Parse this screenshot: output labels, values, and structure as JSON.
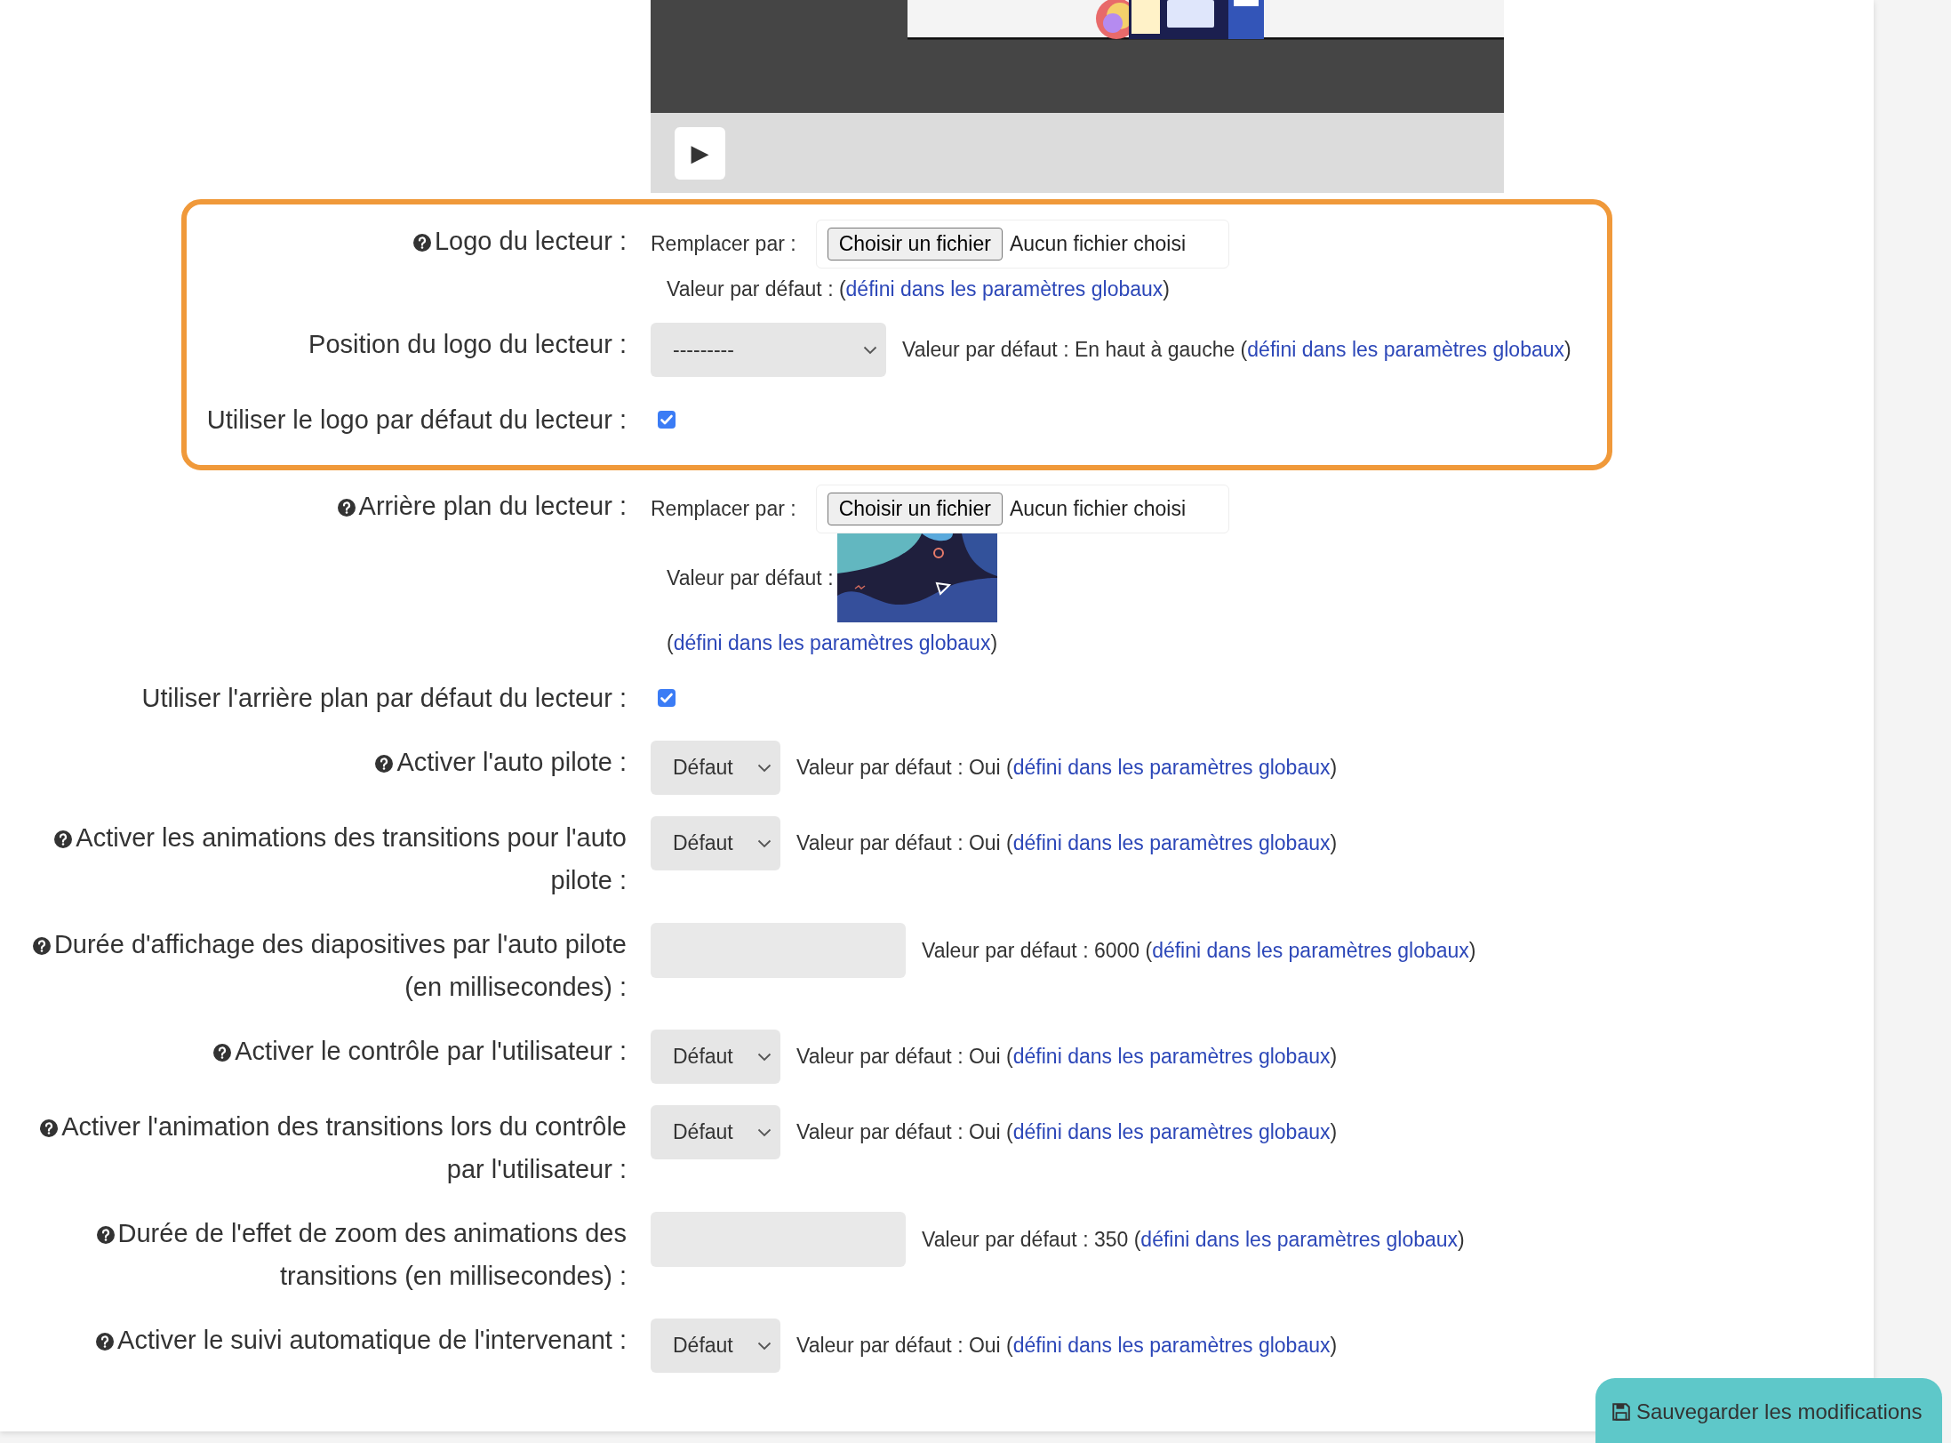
{
  "video_preview": {
    "kind": "picture",
    "play_button": {
      "label": "▶"
    }
  },
  "sections": [
    {
      "highlighted": true,
      "fields": [
        {
          "kind": "file",
          "help": true,
          "label": "Logo du lecteur :",
          "replace_label": "Remplacer par :",
          "button": "Choisir un fichier",
          "file_status": "Aucun fichier choisi",
          "default_prefix": "Valeur par défaut : (",
          "link": "défini dans les paramètres globaux",
          "default_suffix": ")"
        },
        {
          "kind": "select",
          "help": false,
          "label": "Position du logo du lecteur :",
          "value": "---------",
          "default_prefix": "Valeur par défaut : En haut à gauche (",
          "link": "défini dans les paramètres globaux",
          "default_suffix": ")"
        },
        {
          "kind": "checkbox",
          "help": false,
          "label": "Utiliser le logo par défaut du lecteur :",
          "checked": true
        }
      ]
    },
    {
      "highlighted": false,
      "fields": [
        {
          "kind": "file",
          "help": true,
          "label": "Arrière plan du lecteur :",
          "replace_label": "Remplacer par :",
          "button": "Choisir un fichier",
          "file_status": "Aucun fichier choisi",
          "default_prefix": "Valeur par défaut :",
          "default_link_prefix": "(",
          "link": "défini dans les paramètres globaux",
          "default_suffix": ")"
        },
        {
          "kind": "checkbox",
          "help": false,
          "label": "Utiliser l'arrière plan par défaut du lecteur :",
          "checked": true
        },
        {
          "kind": "select",
          "help": true,
          "label": "Activer l'auto pilote :",
          "value": "Défaut",
          "default_prefix": "Valeur par défaut : Oui (",
          "link": "défini dans les paramètres globaux",
          "default_suffix": ")"
        },
        {
          "kind": "select",
          "help": true,
          "label": "Activer les animations des transitions pour l'auto pilote :",
          "value": "Défaut",
          "default_prefix": "Valeur par défaut : Oui (",
          "link": "défini dans les paramètres globaux",
          "default_suffix": ")"
        },
        {
          "kind": "input",
          "help": true,
          "label": "Durée d'affichage des diapositives par l'auto pilote (en millisecondes) :",
          "default_prefix": "Valeur par défaut : 6000 (",
          "link": "défini dans les paramètres globaux",
          "default_suffix": ")"
        },
        {
          "kind": "select",
          "help": true,
          "label": "Activer le contrôle par l'utilisateur :",
          "value": "Défaut",
          "default_prefix": "Valeur par défaut : Oui (",
          "link": "défini dans les paramètres globaux",
          "default_suffix": ")"
        },
        {
          "kind": "select",
          "help": true,
          "label": "Activer l'animation des transitions lors du contrôle par l'utilisateur :",
          "value": "Défaut",
          "default_prefix": "Valeur par défaut : Oui (",
          "link": "défini dans les paramètres globaux",
          "default_suffix": ")"
        },
        {
          "kind": "input",
          "help": true,
          "label": "Durée de l'effet de zoom des animations des transitions (en millisecondes) :",
          "default_prefix": "Valeur par défaut : 350 (",
          "link": "défini dans les paramètres globaux",
          "default_suffix": ")"
        },
        {
          "kind": "select",
          "help": true,
          "label": "Activer le suivi automatique de l'intervenant :",
          "value": "Défaut",
          "default_prefix": "Valeur par défaut : Oui (",
          "link": "défini dans les paramètres globaux",
          "default_suffix": ")"
        }
      ]
    }
  ],
  "save_button": {
    "label": "Sauvegarder les modifications"
  }
}
